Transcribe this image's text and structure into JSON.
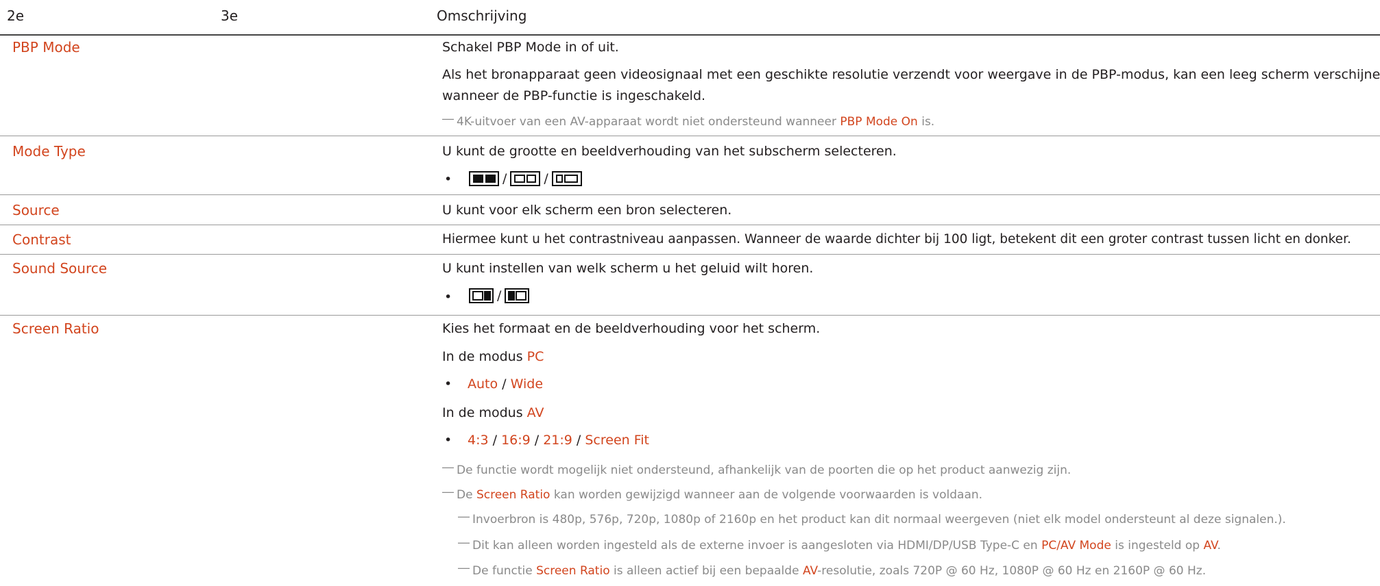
{
  "header": {
    "col1": "2e",
    "col2": "3e",
    "col3": "Omschrijving"
  },
  "rows": {
    "pbp_mode": {
      "title": "PBP Mode",
      "line1": "Schakel PBP Mode in of uit.",
      "line2": "Als het bronapparaat geen videosignaal met een geschikte resolutie verzendt voor weergave in de PBP-modus, kan een leeg scherm verschijnen",
      "line3": "wanneer de PBP-functie is ingeschakeld.",
      "note_dash": "―",
      "note_pre": "4K-uitvoer van een AV-apparaat wordt niet ondersteund wanneer ",
      "note_hl": "PBP Mode On",
      "note_post": " is."
    },
    "mode_type": {
      "title": "Mode Type",
      "line1": "U kunt de grootte en beeldverhouding van het subscherm selecteren.",
      "bullet": "•",
      "sep": "/",
      "icons": [
        "pbp-split-equal-icon",
        "pbp-split-outline-icon",
        "pbp-split-left-small-icon"
      ]
    },
    "source": {
      "title": "Source",
      "line1": "U kunt voor elk scherm een bron selecteren."
    },
    "contrast": {
      "title": "Contrast",
      "line1": "Hiermee kunt u het contrastniveau aanpassen. Wanneer de waarde dichter bij 100 ligt, betekent dit een groter contrast tussen licht en donker."
    },
    "sound_source": {
      "title": "Sound Source",
      "line1": "U kunt instellen van welk scherm u het geluid wilt horen.",
      "bullet": "•",
      "sep": "/",
      "icons": [
        "sound-right-screen-icon",
        "sound-left-screen-icon"
      ]
    },
    "screen_ratio": {
      "title": "Screen Ratio",
      "line1": "Kies het formaat en de beeldverhouding voor het scherm.",
      "pc_pre": "In de modus ",
      "pc_hl": "PC",
      "bullet": "•",
      "pc_opt1": "Auto",
      "sep": " / ",
      "pc_opt2": "Wide",
      "av_pre": "In de modus ",
      "av_hl": "AV",
      "av_opt1": "4:3",
      "av_opt2": "16:9",
      "av_opt3": "21:9",
      "av_opt4": "Screen Fit",
      "note_dash": "―",
      "note1": "De functie wordt mogelijk niet ondersteund, afhankelijk van de poorten die op het product aanwezig zijn.",
      "note2_pre": "De ",
      "note2_hl": "Screen Ratio",
      "note2_post": " kan worden gewijzigd wanneer aan de volgende voorwaarden is voldaan.",
      "sub1": "Invoerbron is 480p, 576p, 720p, 1080p of 2160p en het product kan dit normaal weergeven (niet elk model ondersteunt al deze signalen.).",
      "sub2_pre": "Dit kan alleen worden ingesteld als de externe invoer is aangesloten via HDMI/DP/USB Type-C en ",
      "sub2_hl1": "PC/AV Mode",
      "sub2_mid": " is ingesteld op ",
      "sub2_hl2": "AV",
      "sub2_post": ".",
      "sub3_pre": "De functie ",
      "sub3_hl1": "Screen Ratio",
      "sub3_mid": " is alleen actief bij een bepaalde ",
      "sub3_hl2": "AV",
      "sub3_post": "-resolutie, zoals 720P @ 60 Hz, 1080P @ 60 Hz en 2160P @ 60 Hz."
    }
  },
  "colors": {
    "accent": "#d2451e",
    "note": "#8a8a8a",
    "text": "#231f20"
  }
}
